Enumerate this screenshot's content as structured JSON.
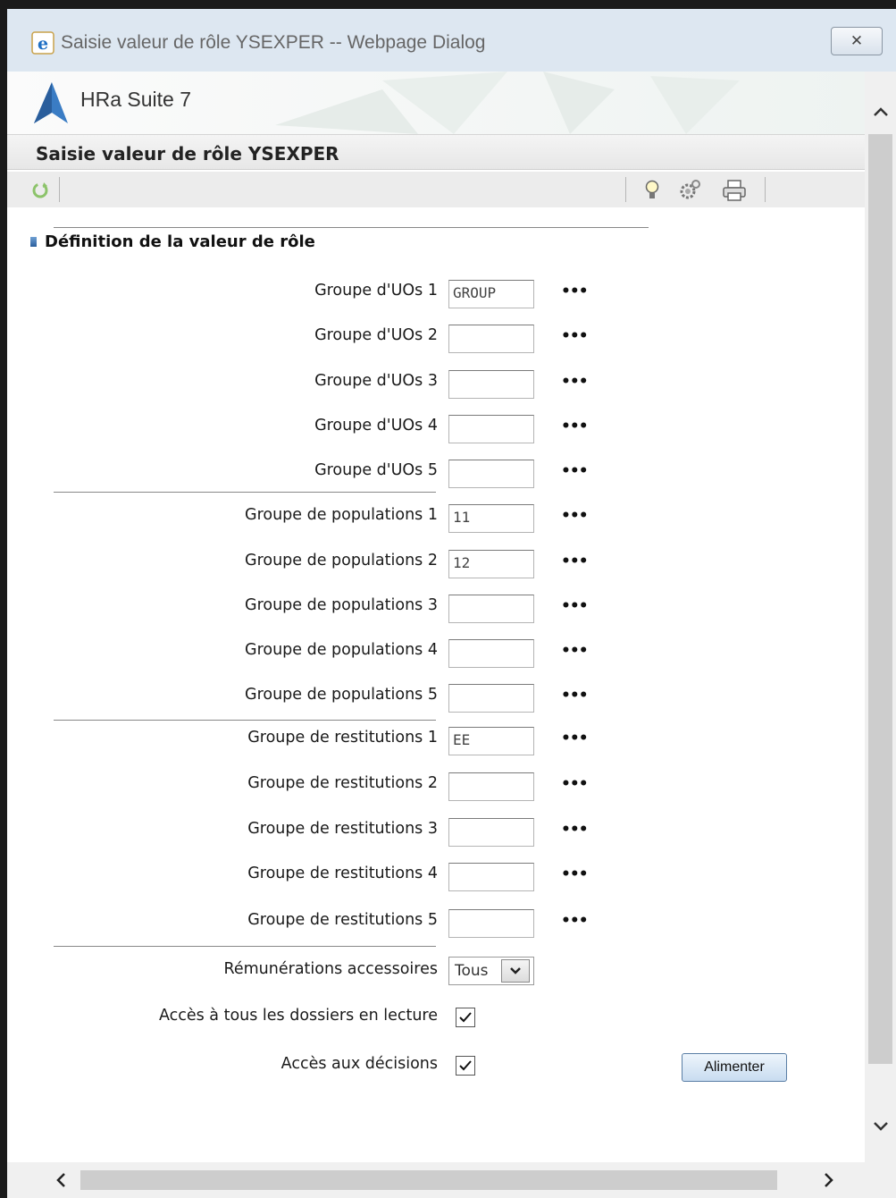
{
  "window": {
    "title": "Saisie valeur de rôle YSEXPER -- Webpage Dialog"
  },
  "brand": {
    "name": "HRa Suite 7"
  },
  "page": {
    "title": "Saisie valeur de rôle YSEXPER"
  },
  "toolbar": {
    "icons": [
      "refresh-icon",
      "lightbulb-icon",
      "settings-icon",
      "printer-icon"
    ]
  },
  "section": {
    "title": "Définition de la valeur de rôle"
  },
  "groups": {
    "uo": [
      {
        "label": "Groupe d'UOs 1",
        "value": "GROUP"
      },
      {
        "label": "Groupe d'UOs 2",
        "value": ""
      },
      {
        "label": "Groupe d'UOs 3",
        "value": ""
      },
      {
        "label": "Groupe d'UOs 4",
        "value": ""
      },
      {
        "label": "Groupe d'UOs 5",
        "value": ""
      }
    ],
    "populations": [
      {
        "label": "Groupe de populations 1",
        "value": "11"
      },
      {
        "label": "Groupe de populations 2",
        "value": "12"
      },
      {
        "label": "Groupe de populations 3",
        "value": ""
      },
      {
        "label": "Groupe de populations 4",
        "value": ""
      },
      {
        "label": "Groupe de populations 5",
        "value": ""
      }
    ],
    "restitutions": [
      {
        "label": "Groupe de restitutions 1",
        "value": "EE"
      },
      {
        "label": "Groupe de restitutions 2",
        "value": ""
      },
      {
        "label": "Groupe de restitutions 3",
        "value": ""
      },
      {
        "label": "Groupe de restitutions 4",
        "value": ""
      },
      {
        "label": "Groupe de restitutions 5",
        "value": ""
      }
    ]
  },
  "lookup_label": "•••",
  "remunerations": {
    "label": "Rémunérations accessoires",
    "selected": "Tous"
  },
  "access_read": {
    "label": "Accès à tous les dossiers en lecture",
    "checked": true
  },
  "access_decisions": {
    "label": "Accès aux décisions",
    "checked": true
  },
  "feed_button": {
    "label": "Alimenter"
  },
  "colors": {
    "title_bar": "#dde7f1",
    "accent": "#2a5e9c",
    "brand": "#3a6fb0"
  }
}
